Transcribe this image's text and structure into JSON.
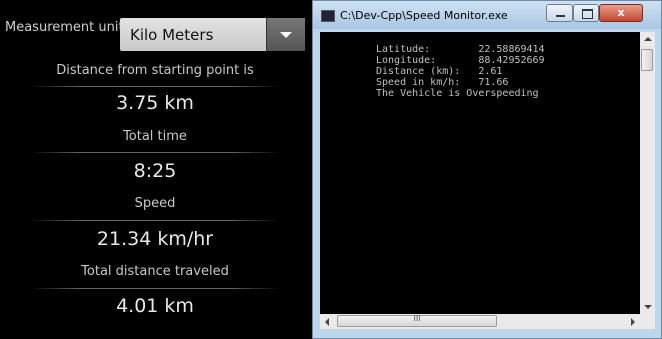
{
  "app": {
    "unit_label": "Measurement unit",
    "unit_selected": "Kilo Meters",
    "stats": [
      {
        "label": "Distance from starting point is",
        "value": "3.75 km"
      },
      {
        "label": "Total time",
        "value": "8:25"
      },
      {
        "label": "Speed",
        "value": "21.34 km/hr"
      },
      {
        "label": "Total distance traveled",
        "value": "4.01 km"
      }
    ]
  },
  "console_window": {
    "title": "C:\\Dev-Cpp\\Speed Monitor.exe",
    "close_glyph": "x",
    "hscroll_grip": "III",
    "lines": [
      "Latitude:        22.58869414",
      "Longitude:       88.42952669",
      "Distance (km):   2.61",
      "Speed in km/h:   71.66",
      "The Vehicle is Overspeeding"
    ]
  }
}
